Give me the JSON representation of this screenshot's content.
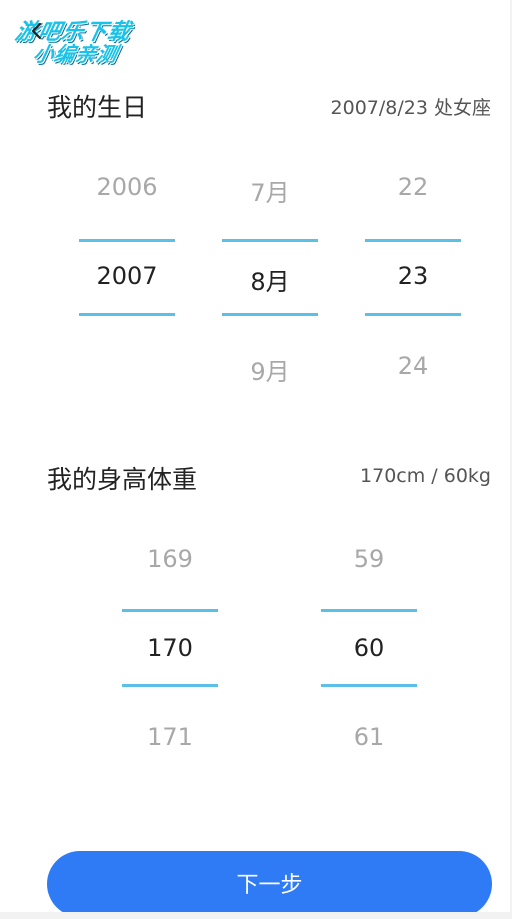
{
  "watermark": {
    "line1": "游吧乐下载",
    "line2": "小编亲测"
  },
  "birthday": {
    "title": "我的生日",
    "summary": "2007/8/23 处女座",
    "year": {
      "prev": "2006",
      "selected": "2007",
      "next": ""
    },
    "month": {
      "prev": "7月",
      "selected": "8月",
      "next": "9月"
    },
    "day": {
      "prev": "22",
      "selected": "23",
      "next": "24"
    }
  },
  "body": {
    "title": "我的身高体重",
    "summary": "170cm / 60kg",
    "height": {
      "prev": "169",
      "selected": "170",
      "next": "171"
    },
    "weight": {
      "prev": "59",
      "selected": "60",
      "next": "61"
    }
  },
  "next_button": {
    "label": "下一步"
  },
  "colors": {
    "accent": "#2f7bf5",
    "picker_line": "#5bc0e8",
    "watermark": "#19c2e8"
  },
  "icons": {
    "back": "chevron-left-icon"
  }
}
